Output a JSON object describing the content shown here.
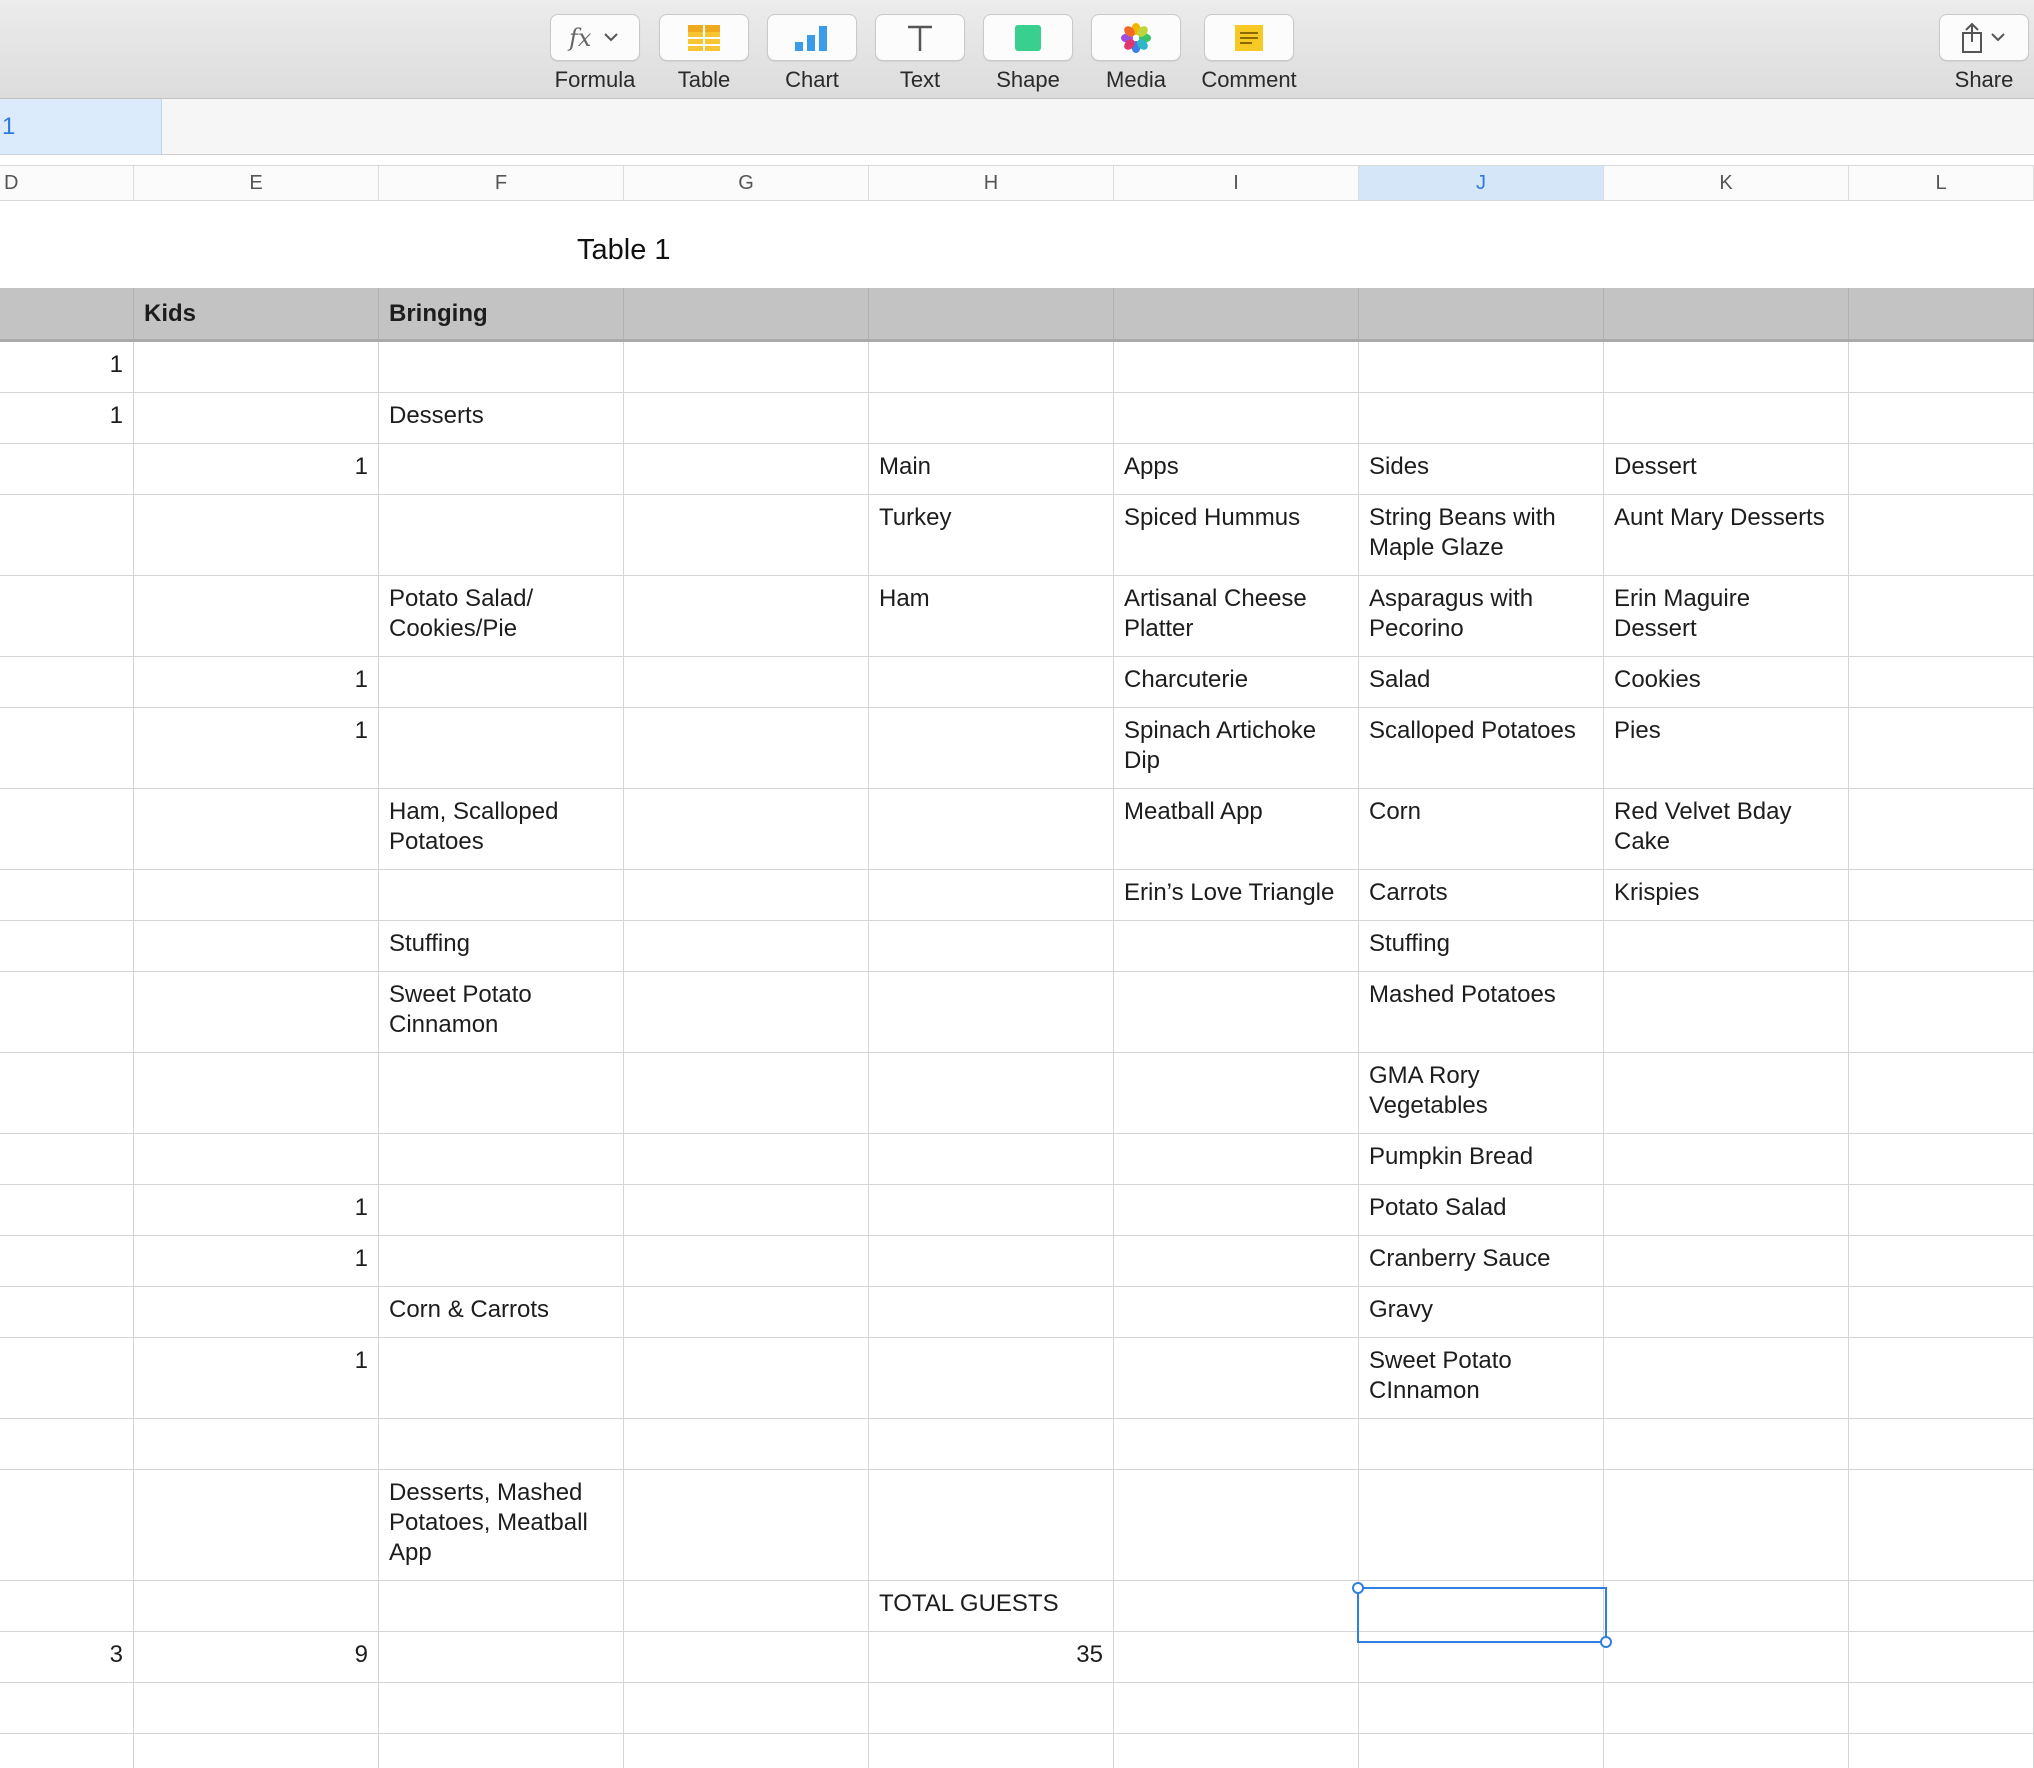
{
  "toolbar": {
    "formula_label": "Formula",
    "table_label": "Table",
    "chart_label": "Chart",
    "text_label": "Text",
    "shape_label": "Shape",
    "media_label": "Media",
    "comment_label": "Comment",
    "share_label": "Share",
    "icons": {
      "formula": "fx-icon",
      "table": "table-icon",
      "chart": "bar-chart-icon",
      "text": "text-T-icon",
      "shape": "shape-square-icon",
      "media": "photos-flower-icon",
      "comment": "comment-note-icon",
      "share": "share-icon"
    }
  },
  "formula_bar": {
    "cell_reference": "1",
    "formula_value": ""
  },
  "columns": [
    "D",
    "E",
    "F",
    "G",
    "H",
    "I",
    "J",
    "K",
    "L"
  ],
  "selected_column": "J",
  "table": {
    "title": "Table 1",
    "header_row": [
      "",
      "Kids",
      "Bringing",
      "",
      "",
      "",
      "",
      "",
      ""
    ],
    "rows": [
      [
        "1",
        "",
        "",
        "",
        "",
        "",
        "",
        "",
        ""
      ],
      [
        "1",
        "",
        "Desserts",
        "",
        "",
        "",
        "",
        "",
        ""
      ],
      [
        "",
        "1",
        "",
        "",
        "Main",
        "Apps",
        "Sides",
        "Dessert",
        ""
      ],
      [
        "",
        "",
        "",
        "",
        "Turkey",
        "Spiced Hummus",
        "String Beans with Maple Glaze",
        "Aunt Mary Desserts",
        ""
      ],
      [
        "",
        "",
        "Potato Salad/ Cookies/Pie",
        "",
        "Ham",
        "Artisanal Cheese Platter",
        "Asparagus with Pecorino",
        "Erin Maguire Dessert",
        ""
      ],
      [
        "",
        "1",
        "",
        "",
        "",
        "Charcuterie",
        "Salad",
        "Cookies",
        ""
      ],
      [
        "",
        "1",
        "",
        "",
        "",
        "Spinach Artichoke Dip",
        "Scalloped Potatoes",
        "Pies",
        ""
      ],
      [
        "",
        "",
        "Ham, Scalloped Potatoes",
        "",
        "",
        "Meatball App",
        "Corn",
        "Red Velvet Bday Cake",
        ""
      ],
      [
        "",
        "",
        "",
        "",
        "",
        "Erin’s Love Triangle",
        "Carrots",
        "Krispies",
        ""
      ],
      [
        "",
        "",
        "Stuffing",
        "",
        "",
        "",
        "Stuffing",
        "",
        ""
      ],
      [
        "",
        "",
        "Sweet Potato Cinnamon",
        "",
        "",
        "",
        "Mashed Potatoes",
        "",
        ""
      ],
      [
        "",
        "",
        "",
        "",
        "",
        "",
        "GMA Rory Vegetables",
        "",
        ""
      ],
      [
        "",
        "",
        "",
        "",
        "",
        "",
        "Pumpkin Bread",
        "",
        ""
      ],
      [
        "",
        "1",
        "",
        "",
        "",
        "",
        "Potato Salad",
        "",
        ""
      ],
      [
        "",
        "1",
        "",
        "",
        "",
        "",
        "Cranberry Sauce",
        "",
        ""
      ],
      [
        "",
        "",
        "Corn & Carrots",
        "",
        "",
        "",
        "Gravy",
        "",
        ""
      ],
      [
        "",
        "1",
        "",
        "",
        "",
        "",
        "Sweet Potato CInnamon",
        "",
        ""
      ],
      [
        "",
        "",
        "",
        "",
        "",
        "",
        "",
        "",
        ""
      ],
      [
        "",
        "",
        "Desserts, Mashed Potatoes, Meatball App",
        "",
        "",
        "",
        "",
        "",
        ""
      ],
      [
        "",
        "",
        "",
        "",
        "TOTAL GUESTS",
        "",
        "",
        "",
        ""
      ],
      [
        "3",
        "9",
        "",
        "",
        "35",
        "",
        "",
        "",
        ""
      ],
      [
        "",
        "",
        "",
        "",
        "",
        "",
        "",
        "",
        ""
      ],
      [
        "",
        "",
        "",
        "",
        "",
        "",
        "",
        "",
        ""
      ]
    ]
  }
}
